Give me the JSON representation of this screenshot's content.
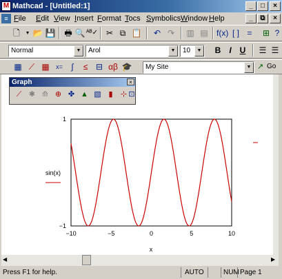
{
  "window": {
    "title": "Mathcad - [Untitled:1]",
    "minimize_glyph": "_",
    "maximize_glyph": "□",
    "close_glyph": "×",
    "doc_minimize_glyph": "_",
    "doc_restore_glyph": "⧉",
    "doc_close_glyph": "×"
  },
  "menu": {
    "items": [
      "File",
      "Edit",
      "View",
      "Insert",
      "Format",
      "Tocs",
      "Symbolics",
      "Window",
      "Help"
    ]
  },
  "format_toolbar": {
    "style_value": "Normal",
    "font_value": "Arol",
    "size_value": "10",
    "bold_label": "B",
    "italic_label": "I",
    "underline_label": "U"
  },
  "math_toolbar": {
    "resource_value": "My Site",
    "go_label": "Go"
  },
  "graph_palette": {
    "title": "Graph",
    "close_glyph": "×"
  },
  "plot": {
    "y_tick_top": "1",
    "y_tick_bottom": "−1",
    "ylabel": "sin(x)",
    "xlabel": "x",
    "x_ticks": [
      "−10",
      "−5",
      "0",
      "5",
      "10"
    ]
  },
  "chart_data": {
    "type": "line",
    "series": [
      {
        "name": "sin(x)",
        "function": "sin(x)"
      }
    ],
    "xlim": [
      -10,
      10
    ],
    "ylim": [
      -1,
      1
    ],
    "x_ticks": [
      -10,
      -5,
      0,
      5,
      10
    ],
    "y_ticks": [
      -1,
      1
    ],
    "xlabel": "x",
    "ylabel": "sin(x)",
    "line_color": "#cc0000",
    "grid": false
  },
  "status": {
    "help_text": "Press F1 for help.",
    "auto_text": "AUTO",
    "num_text": "NUM",
    "page_text": "Page 1"
  }
}
